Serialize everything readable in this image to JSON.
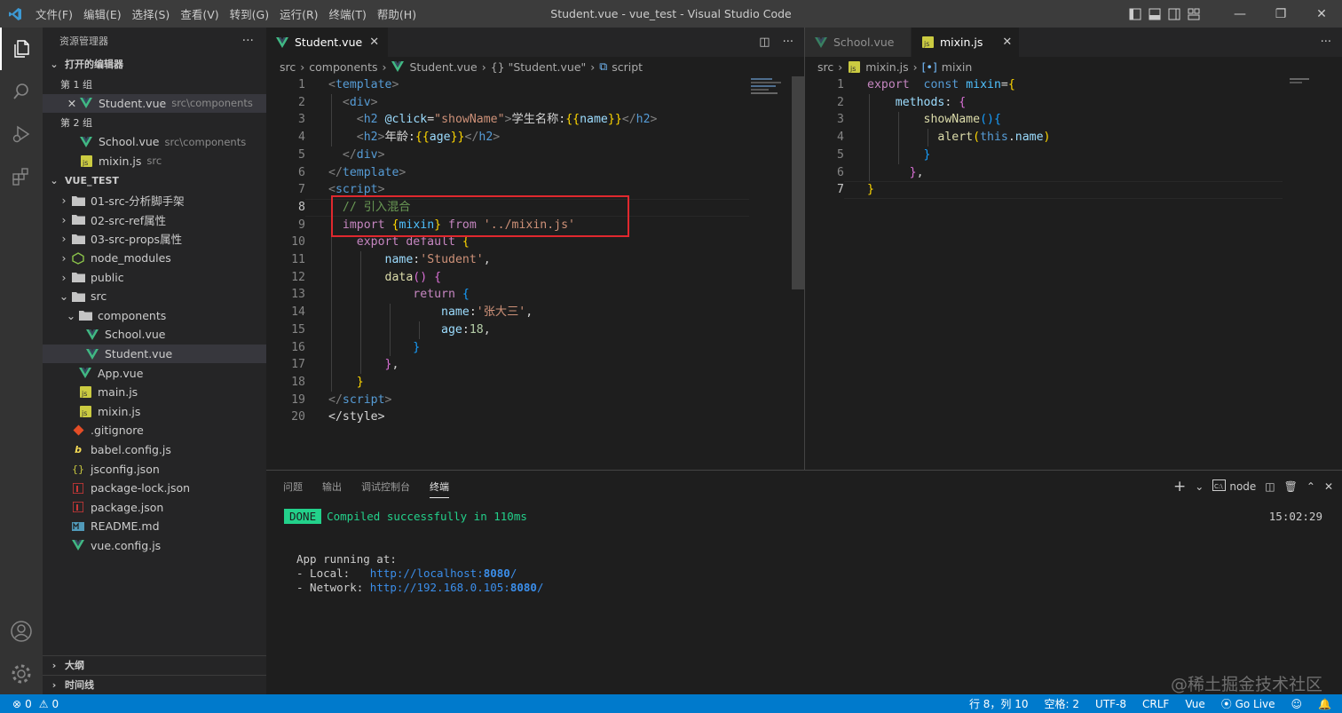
{
  "title_bar": {
    "title": "Student.vue - vue_test - Visual Studio Code",
    "menu": [
      "文件(F)",
      "编辑(E)",
      "选择(S)",
      "查看(V)",
      "转到(G)",
      "运行(R)",
      "终端(T)",
      "帮助(H)"
    ]
  },
  "sidebar": {
    "header": "资源管理器",
    "open_editors": {
      "label": "打开的编辑器",
      "group1": "第 1 组",
      "group2": "第 2 组",
      "items": [
        {
          "name": "Student.vue",
          "desc": "src\\components"
        },
        {
          "name": "School.vue",
          "desc": "src\\components"
        },
        {
          "name": "mixin.js",
          "desc": "src"
        }
      ]
    },
    "project": "VUE_TEST",
    "tree": [
      "01-src-分析脚手架",
      "02-src-ref属性",
      "03-src-props属性",
      "node_modules",
      "public",
      "src",
      "components",
      "School.vue",
      "Student.vue",
      "App.vue",
      "main.js",
      "mixin.js",
      ".gitignore",
      "babel.config.js",
      "jsconfig.json",
      "package-lock.json",
      "package.json",
      "README.md",
      "vue.config.js"
    ],
    "outline": "大纲",
    "timeline": "时间线"
  },
  "editor1": {
    "tab": "Student.vue",
    "breadcrumb": [
      "src",
      "components",
      "Student.vue",
      "{} \"Student.vue\"",
      "script"
    ],
    "line_numbers": [
      "1",
      "2",
      "3",
      "4",
      "5",
      "6",
      "7",
      "8",
      "9",
      "10",
      "11",
      "12",
      "13",
      "14",
      "15",
      "16",
      "17",
      "18",
      "19",
      "20"
    ]
  },
  "editor2": {
    "tabs": [
      "School.vue",
      "mixin.js"
    ],
    "breadcrumb": [
      "src",
      "mixin.js",
      "mixin"
    ],
    "line_numbers": [
      "1",
      "2",
      "3",
      "4",
      "5",
      "6",
      "7"
    ]
  },
  "panel": {
    "tabs": [
      "问题",
      "输出",
      "调试控制台",
      "终端"
    ],
    "shell": "node",
    "time": "15:02:29",
    "done_badge": "DONE",
    "compiled": "Compiled successfully in 110ms",
    "running": "App running at:",
    "local_label": "- Local:   ",
    "local_url_a": "http://localhost:",
    "local_port": "8080",
    "local_url_b": "/",
    "network_label": "- Network: ",
    "network_url_a": "http://192.168.0.105:",
    "network_port": "8080",
    "network_url_b": "/"
  },
  "status": {
    "errors": "0",
    "warnings": "0",
    "position": "行 8，列 10",
    "spaces": "空格: 2",
    "encoding": "UTF-8",
    "eol": "CRLF",
    "language": "Vue",
    "golive": "Go Live"
  },
  "watermark": "@稀土掘金技术社区"
}
